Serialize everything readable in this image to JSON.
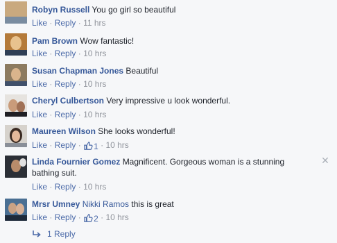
{
  "comments": [
    {
      "name": "Robyn Russell",
      "text": "You go girl so beautiful",
      "like": "Like",
      "reply": "Reply",
      "time": "11 hrs",
      "likes": ""
    },
    {
      "name": "Pam Brown",
      "text": "Wow fantastic!",
      "like": "Like",
      "reply": "Reply",
      "time": "10 hrs",
      "likes": ""
    },
    {
      "name": "Susan Chapman Jones",
      "text": "Beautiful",
      "like": "Like",
      "reply": "Reply",
      "time": "10 hrs",
      "likes": ""
    },
    {
      "name": "Cheryl Culbertson",
      "text": "Very impressive u look wonderful.",
      "like": "Like",
      "reply": "Reply",
      "time": "10 hrs",
      "likes": ""
    },
    {
      "name": "Maureen Wilson",
      "text": "She looks wonderful!",
      "like": "Like",
      "reply": "Reply",
      "time": "10 hrs",
      "likes": "1"
    },
    {
      "name": "Linda Fournier Gomez",
      "text": "Magnificent. Gorgeous woman is a stunning bathing suit.",
      "like": "Like",
      "reply": "Reply",
      "time": "10 hrs",
      "likes": ""
    },
    {
      "name": "Mrsr Umney",
      "tag": "Nikki Ramos",
      "text": "this is great",
      "like": "Like",
      "reply": "Reply",
      "time": "10 hrs",
      "likes": "2"
    }
  ],
  "separator": "·",
  "close_glyph": "✕",
  "reply_link": "1 Reply",
  "colors": {
    "link": "#365899",
    "meta": "#90949c",
    "background": "#f6f7f9"
  }
}
